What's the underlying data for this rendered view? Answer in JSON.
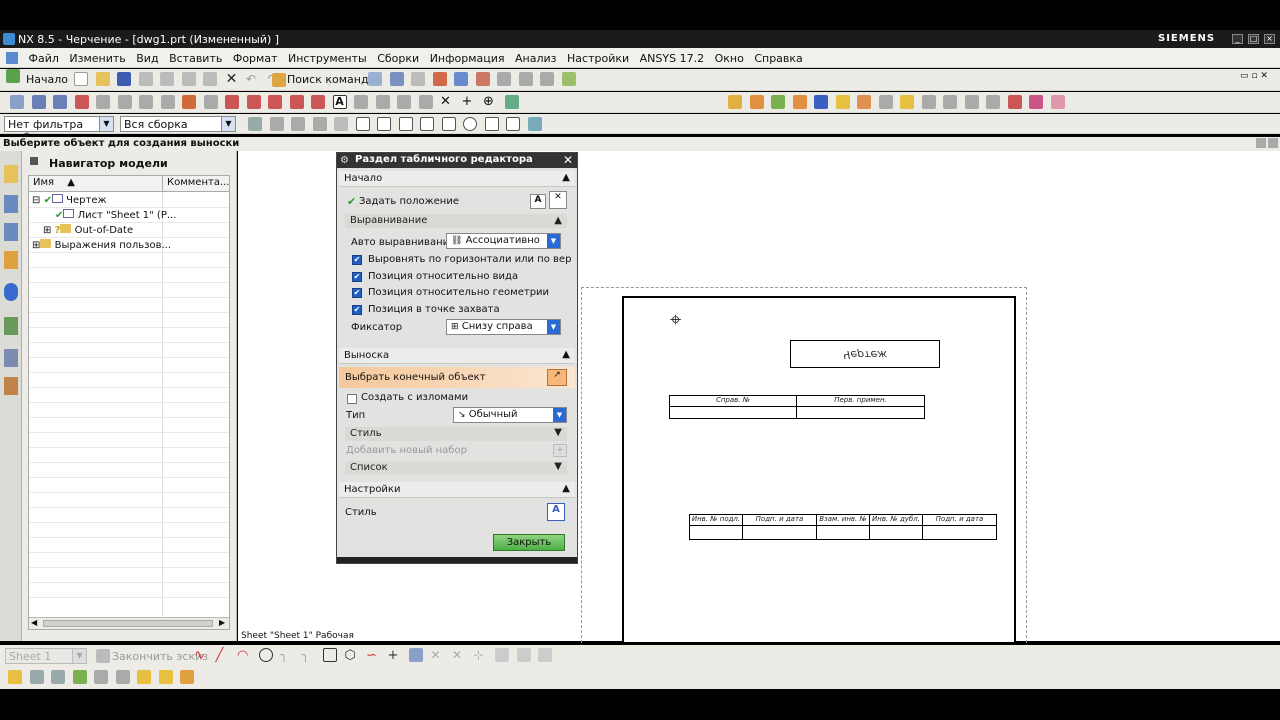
{
  "window": {
    "title": "NX 8.5 - Черчение - [dwg1.prt (Измененный) ]",
    "brand": "SIEMENS",
    "btn_min": "_",
    "btn_max": "□",
    "btn_close": "×"
  },
  "menu": [
    "Файл",
    "Изменить",
    "Вид",
    "Вставить",
    "Формат",
    "Инструменты",
    "Сборки",
    "Информация",
    "Анализ",
    "Настройки",
    "ANSYS 17.2",
    "Окно",
    "Справка"
  ],
  "toolbar": {
    "start_label": "Начало",
    "command_search": "Поиск команды"
  },
  "filters": {
    "type_filter": "Нет фильтра выбор",
    "scope_filter": "Вся сборка"
  },
  "status": {
    "prompt": "Выберите объект для создания выноски",
    "sheet_info": "Sheet \"Sheet 1\" Рабочая"
  },
  "navigator": {
    "title": "Навигатор модели",
    "col_name": "Имя",
    "col_comment": "Коммента...",
    "tree": [
      {
        "label": "Чертеж",
        "icon": "drawing-icon"
      },
      {
        "label": "Лист \"Sheet 1\" (Р...",
        "icon": "sheet-icon"
      },
      {
        "label": "Out-of-Date",
        "icon": "folder-icon"
      },
      {
        "label": "Выражения пользов...",
        "icon": "folder-icon"
      }
    ]
  },
  "dialog": {
    "title": "Раздел табличного редактора",
    "sec_start": "Начало",
    "set_position": "Задать положение",
    "sec_align": "Выравнивание",
    "auto_align_label": "Авто выравнивани",
    "auto_align_value": "Ассоциативно",
    "checks": [
      {
        "label": "Выровнять по горизонтали или по вер",
        "checked": true
      },
      {
        "label": "Позиция относительно вида",
        "checked": true
      },
      {
        "label": "Позиция относительно геометрии",
        "checked": true
      },
      {
        "label": "Позиция в точке захвата",
        "checked": true
      }
    ],
    "anchor_label": "Фиксатор",
    "anchor_value": "Снизу справа",
    "sec_leader": "Выноска",
    "select_end": "Выбрать конечный объект",
    "create_jogs": "Создать с изломами",
    "create_jogs_checked": false,
    "type_label": "Тип",
    "type_value": "Обычный",
    "style_sub": "Стиль",
    "add_set": "Добавить новый набор",
    "list_sub": "Список",
    "sec_settings": "Настройки",
    "style_label": "Стиль",
    "close_btn": "Закрыть"
  },
  "drawing": {
    "title_text": "Чертеж",
    "top_table": [
      "Справ. №",
      "Перв. примен."
    ],
    "bottom_table": [
      "Инв. № подл.",
      "Подп. и дата",
      "Взам. инв. №",
      "Инв. № дубл.",
      "Подп. и дата"
    ]
  },
  "sketch_toolbar": {
    "sheet_select": "Sheet 1",
    "finish_sketch": "Закончить эскиз"
  },
  "colors": {
    "accent": "#2a6ad4",
    "highlight": "#f5c89a",
    "close_green": "#5cbd50"
  }
}
